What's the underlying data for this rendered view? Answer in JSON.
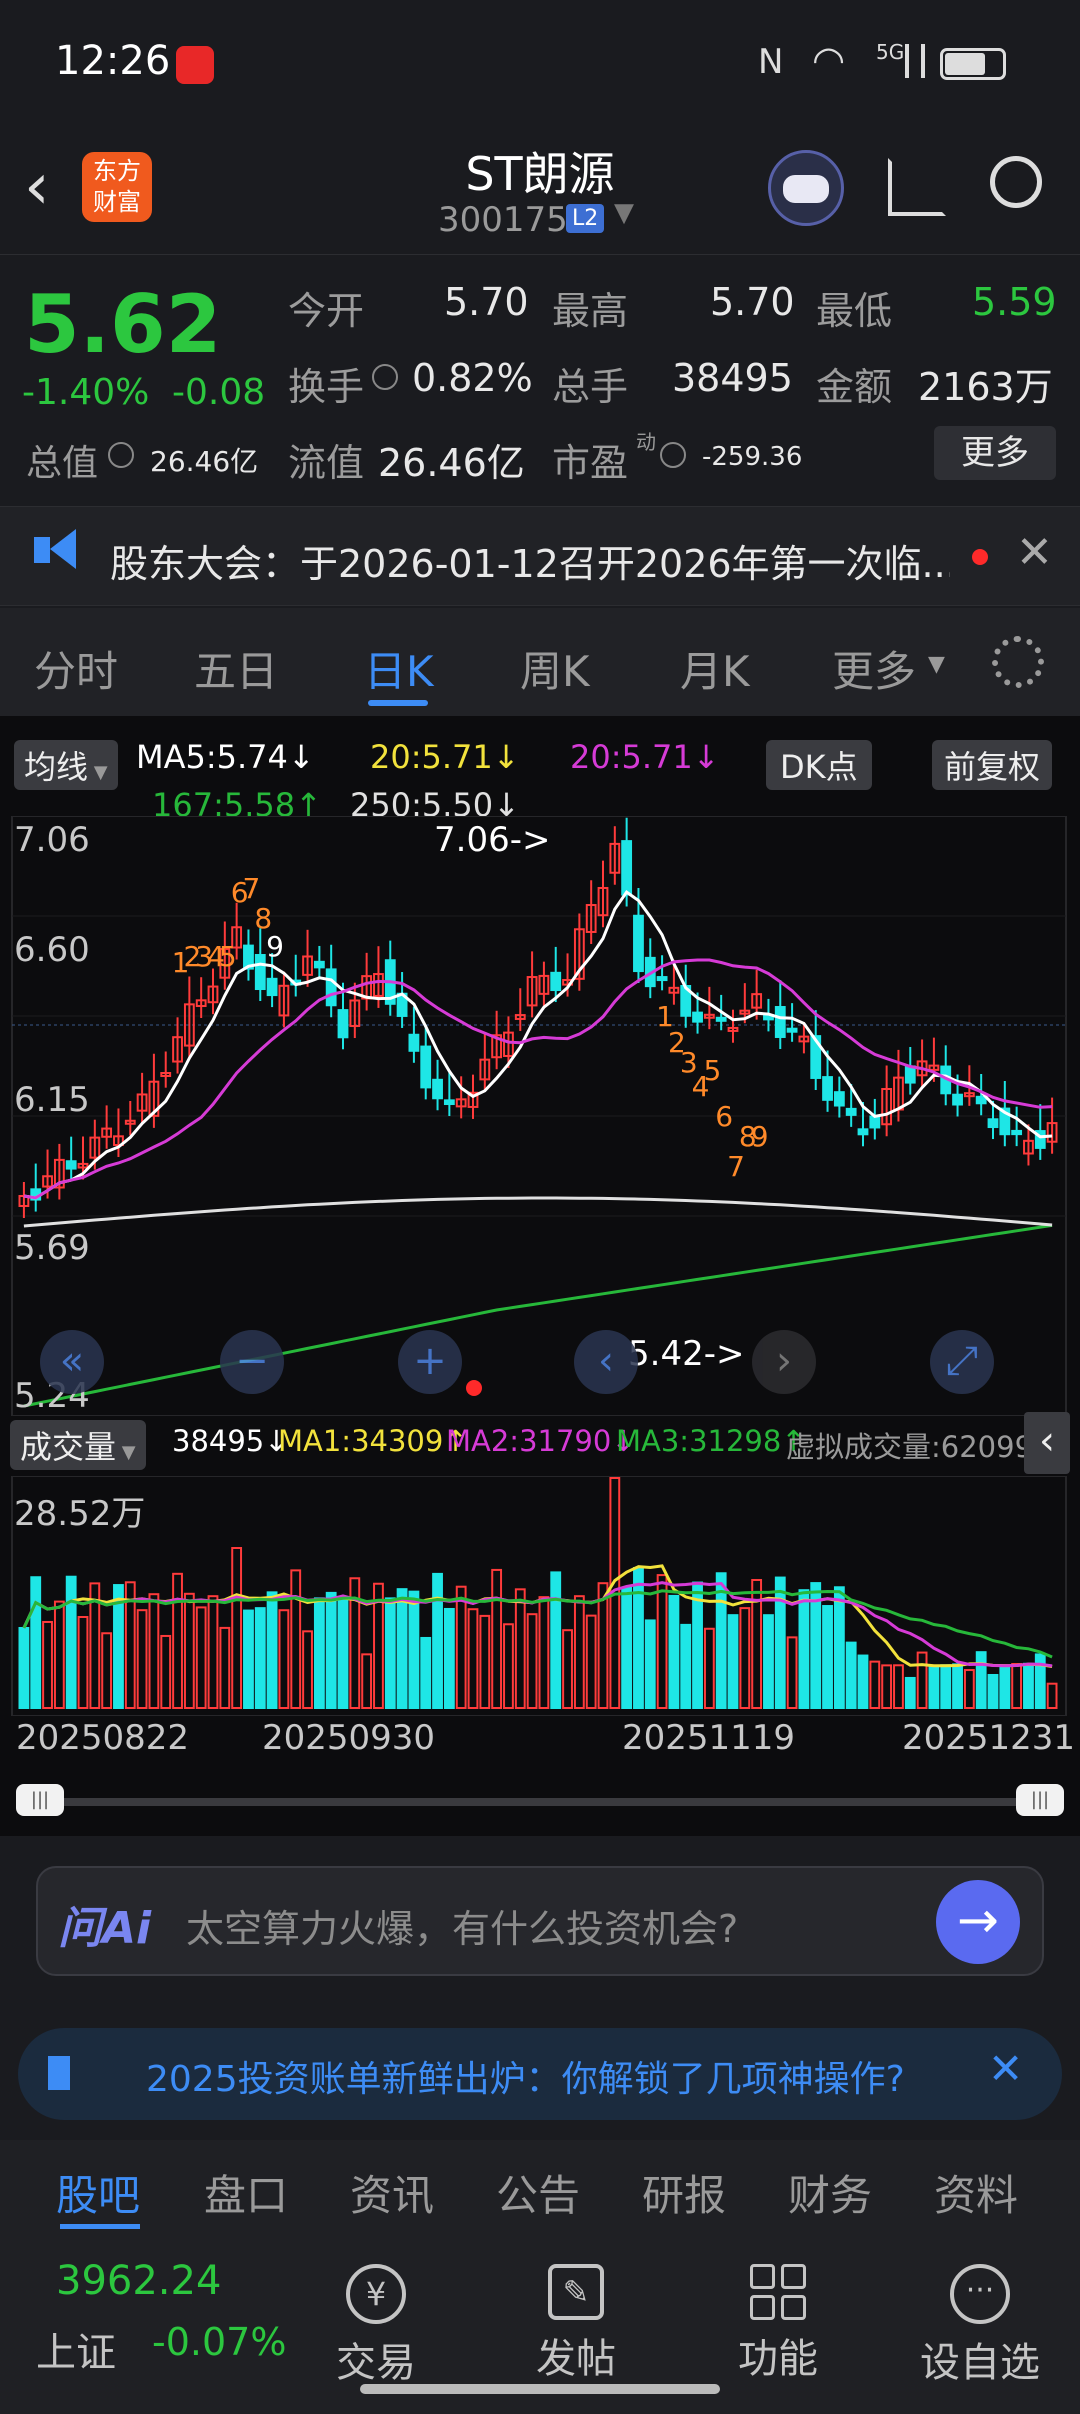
{
  "status": {
    "time": "12:26",
    "network": "5G"
  },
  "header": {
    "title": "ST朗源",
    "code": "300175",
    "level": "L2",
    "brand_line1": "东方",
    "brand_line2": "财富"
  },
  "quote": {
    "price": "5.62",
    "change_pct": "-1.40%",
    "change": "-0.08",
    "open_label": "今开",
    "open": "5.70",
    "high_label": "最高",
    "high": "5.70",
    "low_label": "最低",
    "low": "5.59",
    "turnover_label": "换手",
    "turnover": "0.82%",
    "volume_label": "总手",
    "volume": "38495",
    "amount_label": "金额",
    "amount": "2163万",
    "mktcap_label": "总值",
    "mktcap": "26.46亿",
    "float_label": "流值",
    "float": "26.46亿",
    "pe_label": "市盈",
    "pe_sup": "动",
    "pe": "-259.36",
    "more_button": "更多"
  },
  "notice": {
    "text": "股东大会：于2026-01-12召开2026年第一次临..."
  },
  "tabs": [
    "分时",
    "五日",
    "日K",
    "周K",
    "月K",
    "更多"
  ],
  "active_tab": "日K",
  "ma_bar": {
    "selector": "均线",
    "ma5": "MA5:5.74↓",
    "ma20a": "20:5.71↓",
    "ma20b": "20:5.71↓",
    "ma167": "167:5.58↑",
    "ma250": "250:5.50↓",
    "dk_button": "DK点",
    "adjust_button": "前复权"
  },
  "price_axis": [
    "7.06",
    "6.60",
    "6.15",
    "5.69",
    "5.24"
  ],
  "annotations": {
    "high": "7.06->",
    "low": "5.42->"
  },
  "signals": [
    "1",
    "2",
    "3",
    "4",
    "5",
    "6",
    "7",
    "8",
    "9",
    "1",
    "2",
    "3",
    "4",
    "5",
    "6",
    "7",
    "8",
    "9"
  ],
  "vol_bar": {
    "selector": "成交量",
    "vol": "38495↓",
    "ma1": "MA1:34309↑",
    "ma2": "MA2:31790↓",
    "ma3": "MA3:31298↑",
    "virtual": "虚拟成交量:62099"
  },
  "vol_axis": "28.52万",
  "dates": [
    "20250822",
    "20250930",
    "20251119",
    "20251231"
  ],
  "ask": {
    "logo": "问Ai",
    "placeholder": "太空算力火爆，有什么投资机会?"
  },
  "promo": {
    "text": "2025投资账单新鲜出炉：你解锁了几项神操作?"
  },
  "bottom_tabs": [
    "股吧",
    "盘口",
    "资讯",
    "公告",
    "研报",
    "财务",
    "资料"
  ],
  "index": {
    "value": "3962.24",
    "name": "上证",
    "change": "-0.07%"
  },
  "bottom_actions": [
    "交易",
    "发帖",
    "功能",
    "设自选"
  ],
  "colors": {
    "up": "#ff3b3b",
    "down": "#1ee6e6",
    "accent": "#3d8cf5",
    "ma5": "#ffffff",
    "ma20": "#d63bd6",
    "ma167": "#27b83a",
    "ma250": "#e0e0e0"
  }
}
